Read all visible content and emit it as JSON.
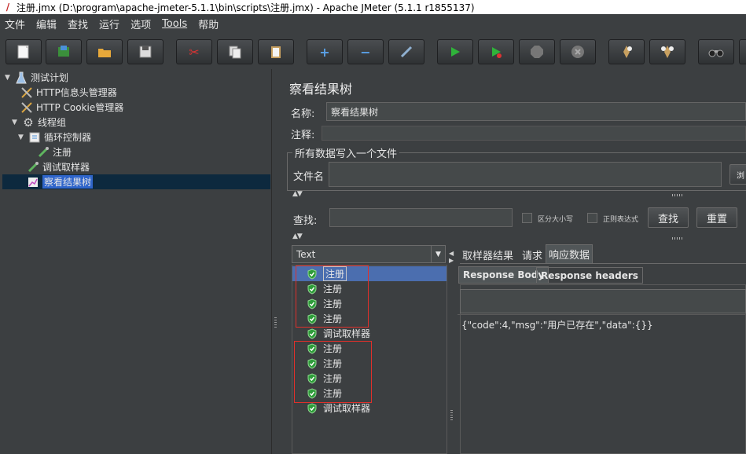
{
  "window": {
    "title": "注册.jmx (D:\\program\\apache-jmeter-5.1.1\\bin\\scripts\\注册.jmx) - Apache JMeter (5.1.1 r1855137)"
  },
  "menu": [
    "文件",
    "编辑",
    "查找",
    "运行",
    "选项",
    "Tools",
    "帮助"
  ],
  "toolbar": [
    {
      "name": "new-icon"
    },
    {
      "name": "templates-icon"
    },
    {
      "name": "open-icon"
    },
    {
      "name": "save-icon"
    },
    {
      "name": "cut-icon"
    },
    {
      "name": "copy-icon"
    },
    {
      "name": "paste-icon"
    },
    {
      "name": "expand-icon"
    },
    {
      "name": "collapse-icon"
    },
    {
      "name": "toggle-icon"
    },
    {
      "name": "start-icon"
    },
    {
      "name": "start-no-pause-icon"
    },
    {
      "name": "stop-icon"
    },
    {
      "name": "shutdown-icon"
    },
    {
      "name": "clear-icon"
    },
    {
      "name": "clear-all-icon"
    },
    {
      "name": "search-icon"
    }
  ],
  "tree": [
    {
      "label": "测试计划",
      "icon": "flask-icon",
      "level": 0,
      "twisty": "▼"
    },
    {
      "label": "HTTP信息头管理器",
      "icon": "tools-icon",
      "level": 1,
      "twisty": ""
    },
    {
      "label": "HTTP Cookie管理器",
      "icon": "tools-icon",
      "level": 1,
      "twisty": ""
    },
    {
      "label": "线程组",
      "icon": "gear-icon",
      "level": 1,
      "twisty": "▼"
    },
    {
      "label": "循环控制器",
      "icon": "controller-icon",
      "level": 2,
      "twisty": "▼"
    },
    {
      "label": "注册",
      "icon": "pipette-icon",
      "level": 3,
      "twisty": ""
    },
    {
      "label": "调试取样器",
      "icon": "pipette-icon",
      "level": 2,
      "twisty": ""
    },
    {
      "label": "察看结果树",
      "icon": "chart-icon",
      "level": 2,
      "twisty": "",
      "selected": true
    }
  ],
  "panel": {
    "title": "察看结果树",
    "name_label": "名称:",
    "name_value": "察看结果树",
    "comment_label": "注释:",
    "comment_value": "",
    "file_group_title": "所有数据写入一个文件",
    "filename_label": "文件名",
    "filename_value": "",
    "browse_label": "浏",
    "search_label": "查找:",
    "search_value": "",
    "case_label": "区分大小写",
    "regex_label": "正则表达式",
    "search_button": "查找",
    "reset_button": "重置"
  },
  "renderer": {
    "selected": "Text"
  },
  "results": [
    {
      "label": "注册",
      "selected": true
    },
    {
      "label": "注册"
    },
    {
      "label": "注册"
    },
    {
      "label": "注册"
    },
    {
      "label": "调试取样器"
    },
    {
      "label": "注册"
    },
    {
      "label": "注册"
    },
    {
      "label": "注册"
    },
    {
      "label": "注册"
    },
    {
      "label": "调试取样器"
    }
  ],
  "tabs": {
    "sampler_result": "取样器结果",
    "request": "请求",
    "response_data": "响应数据"
  },
  "subtabs": {
    "body": "Response Body",
    "headers": "Response headers"
  },
  "response": {
    "body": "{\"code\":4,\"msg\":\"用户已存在\",\"data\":{}}"
  },
  "colors": {
    "background": "#3c3f41",
    "selection": "#4b6eaf",
    "highlight_box": "#e0302b",
    "success": "#2e9c3a"
  }
}
